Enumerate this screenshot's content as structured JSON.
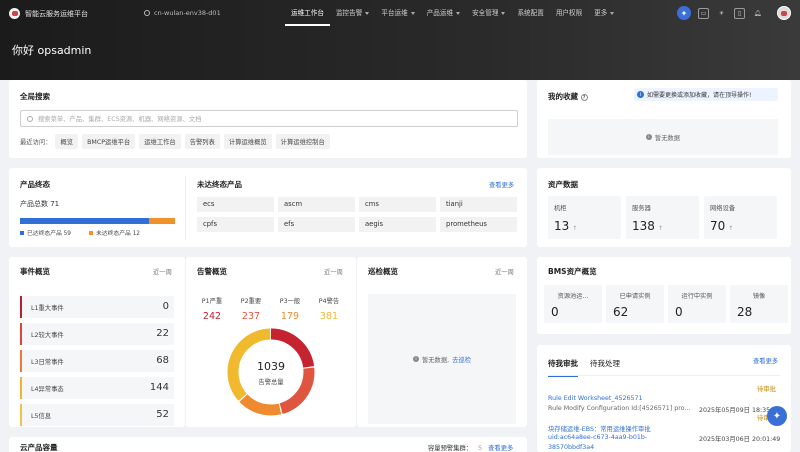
{
  "app": {
    "name": "智能云服务运维平台",
    "env": "cn-wulan-env38-d01"
  },
  "nav": [
    {
      "label": "运维工作台",
      "active": true,
      "caret": false
    },
    {
      "label": "监控告警",
      "caret": true
    },
    {
      "label": "平台运维",
      "caret": true
    },
    {
      "label": "产品运维",
      "caret": true
    },
    {
      "label": "安全管理",
      "caret": true
    },
    {
      "label": "系统配置",
      "caret": false
    },
    {
      "label": "用户权限",
      "caret": false
    },
    {
      "label": "更多",
      "caret": true
    }
  ],
  "greeting": "你好 opsadmin",
  "search": {
    "title": "全局搜索",
    "placeholder": "搜索菜单、产品、集群、ECS资源、机器、网络资源、文档",
    "recent_label": "最近访问：",
    "recent": [
      "概览",
      "BMCP运维平台",
      "运维工作台",
      "告警列表",
      "计算运维概览",
      "计算运维控制台"
    ]
  },
  "favorites": {
    "title": "我的收藏",
    "tip": "如需要更换或添加收藏，请在顶导操作!",
    "empty": "暂无数据"
  },
  "product_status": {
    "title": "产品终态",
    "total_label": "产品总数 71",
    "reached": {
      "label": "已达终态产品 59",
      "value": 59,
      "color": "#2f6fd6"
    },
    "unreached": {
      "label": "未达终态产品 12",
      "value": 12,
      "color": "#f0922b"
    }
  },
  "unreached_products": {
    "title": "未达终态产品",
    "more": "查看更多",
    "items": [
      "ecs",
      "ascm",
      "cms",
      "tianji",
      "cpfs",
      "efs",
      "aegis",
      "prometheus"
    ]
  },
  "assets": {
    "title": "资产数据",
    "items": [
      {
        "label": "机柜",
        "value": "13"
      },
      {
        "label": "服务器",
        "value": "138"
      },
      {
        "label": "网络设备",
        "value": "70"
      }
    ]
  },
  "events": {
    "title": "事件概览",
    "period": "近一周",
    "items": [
      {
        "label": "L1重大事件",
        "value": "0",
        "color": "#b8212f"
      },
      {
        "label": "L2较大事件",
        "value": "22",
        "color": "#d9443d"
      },
      {
        "label": "L3日常事件",
        "value": "68",
        "color": "#ee7a36"
      },
      {
        "label": "L4异常事态",
        "value": "144",
        "color": "#f2b52b"
      },
      {
        "label": "L5信息",
        "value": "52",
        "color": "#e8c84a"
      }
    ]
  },
  "alerts": {
    "title": "告警概览",
    "period": "近一周",
    "total": "1039",
    "total_label": "告警总量",
    "items": [
      {
        "label": "P1严重",
        "value": 242,
        "color": "#c4232f"
      },
      {
        "label": "P2重要",
        "value": 237,
        "color": "#e0553f"
      },
      {
        "label": "P3一般",
        "value": 179,
        "color": "#ef8a2e"
      },
      {
        "label": "P4警告",
        "value": 381,
        "color": "#f0b92e"
      }
    ]
  },
  "inspection": {
    "title": "巡检概览",
    "period": "近一周",
    "empty": "暂无数据,",
    "action": "去巡检"
  },
  "bms": {
    "title": "BMS资产概览",
    "items": [
      {
        "label": "资源池运...",
        "value": "0"
      },
      {
        "label": "已申请实例",
        "value": "62"
      },
      {
        "label": "运行中实例",
        "value": "0"
      },
      {
        "label": "镜像",
        "value": "28"
      }
    ]
  },
  "approvals": {
    "tabs": [
      "待我审批",
      "待我处理"
    ],
    "more": "查看更多",
    "items": [
      {
        "status": "待审批",
        "title": "Rule Edit Worksheet_4526571",
        "desc": "Rule Modify Configuration Id:[4526571] pro...",
        "time": "2025年05月09日 18:35"
      },
      {
        "status": "待审批",
        "title": "块存储运维-EBS：常用运维操作审批",
        "desc": "uid:ac64a8ee-c673-4aa9-b01b-",
        "desc2": "38570bbdf3a4",
        "time": "2025年03月06日 20:01:49"
      }
    ]
  },
  "cloud_capacity": {
    "title": "云产品容量",
    "warn_label": "容量预警集群：",
    "warn_count": "5",
    "more": "查看更多"
  }
}
